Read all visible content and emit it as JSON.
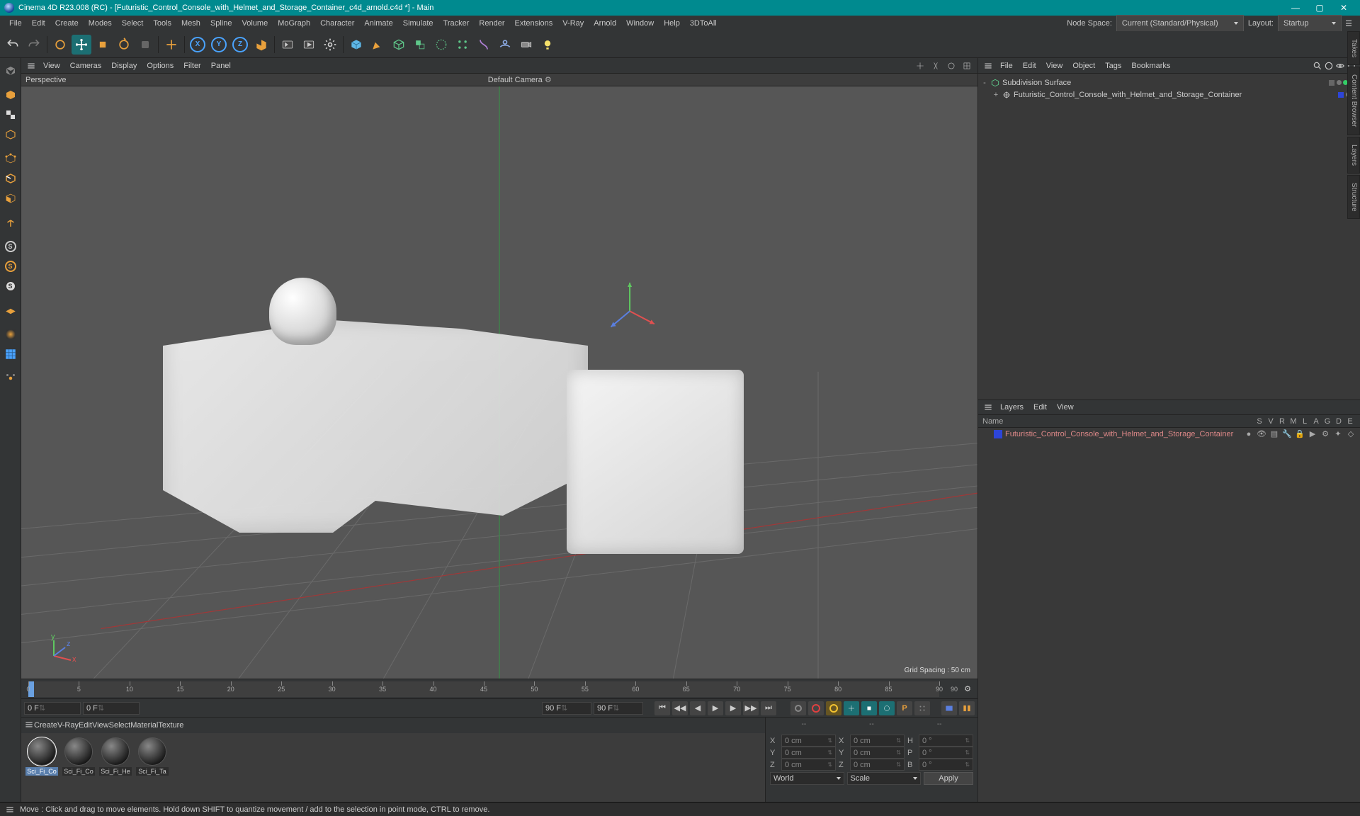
{
  "titlebar": {
    "text": "Cinema 4D R23.008 (RC) - [Futuristic_Control_Console_with_Helmet_and_Storage_Container_c4d_arnold.c4d *] - Main"
  },
  "menu": {
    "items": [
      "File",
      "Edit",
      "Create",
      "Modes",
      "Select",
      "Tools",
      "Mesh",
      "Spline",
      "Volume",
      "MoGraph",
      "Character",
      "Animate",
      "Simulate",
      "Tracker",
      "Render",
      "Extensions",
      "V-Ray",
      "Arnold",
      "Window",
      "Help",
      "3DToAll"
    ],
    "nodespace_label": "Node Space:",
    "nodespace_value": "Current (Standard/Physical)",
    "layout_label": "Layout:",
    "layout_value": "Startup"
  },
  "vp_menu": {
    "items": [
      "View",
      "Cameras",
      "Display",
      "Options",
      "Filter",
      "Panel"
    ]
  },
  "viewport": {
    "label_left": "Perspective",
    "label_center": "Default Camera",
    "grid_label": "Grid Spacing : 50 cm"
  },
  "obj_menu": {
    "items": [
      "File",
      "Edit",
      "View",
      "Object",
      "Tags",
      "Bookmarks"
    ]
  },
  "objects": [
    {
      "name": "Subdivision Surface",
      "depth": 0,
      "kind": "subdiv",
      "expand": "-"
    },
    {
      "name": "Futuristic_Control_Console_with_Helmet_and_Storage_Container",
      "depth": 1,
      "kind": "null",
      "expand": "+"
    }
  ],
  "layers_menu": {
    "items": [
      "Layers",
      "Edit",
      "View"
    ]
  },
  "layers_hdr": {
    "name": "Name",
    "cols": [
      "S",
      "V",
      "R",
      "M",
      "L",
      "A",
      "G",
      "D",
      "E"
    ]
  },
  "layers": [
    {
      "name": "Futuristic_Control_Console_with_Helmet_and_Storage_Container",
      "color": "#2d45d8"
    }
  ],
  "side_tabs": [
    "Takes",
    "Content Browser",
    "Layers",
    "Structure"
  ],
  "timeline": {
    "major": [
      0,
      5,
      10,
      15,
      20,
      25,
      30,
      35,
      40,
      45,
      50,
      55,
      60,
      65,
      70,
      75,
      80,
      85,
      90
    ],
    "end_label": "90"
  },
  "playback": {
    "f_start": "0 F",
    "f_cur": "0 F",
    "f_prev1": "90 F",
    "f_prev2": "90 F"
  },
  "mat_menu": {
    "items": [
      "Create",
      "V-Ray",
      "Edit",
      "View",
      "Select",
      "Material",
      "Texture"
    ]
  },
  "materials": [
    {
      "label": "Sci_Fi_Co",
      "sel": true
    },
    {
      "label": "Sci_Fi_Co"
    },
    {
      "label": "Sci_Fi_He"
    },
    {
      "label": "Sci_Fi_Ta"
    }
  ],
  "coord": {
    "head": [
      "--",
      "--",
      "--"
    ],
    "rows": [
      {
        "a": "X",
        "av": "0 cm",
        "b": "X",
        "bv": "0 cm",
        "c": "H",
        "cv": "0 °"
      },
      {
        "a": "Y",
        "av": "0 cm",
        "b": "Y",
        "bv": "0 cm",
        "c": "P",
        "cv": "0 °"
      },
      {
        "a": "Z",
        "av": "0 cm",
        "b": "Z",
        "bv": "0 cm",
        "c": "B",
        "cv": "0 °"
      }
    ],
    "mode1": "World",
    "mode2": "Scale",
    "apply": "Apply"
  },
  "status": {
    "text": "Move : Click and drag to move elements. Hold down SHIFT to quantize movement / add to the selection in point mode, CTRL to remove."
  }
}
